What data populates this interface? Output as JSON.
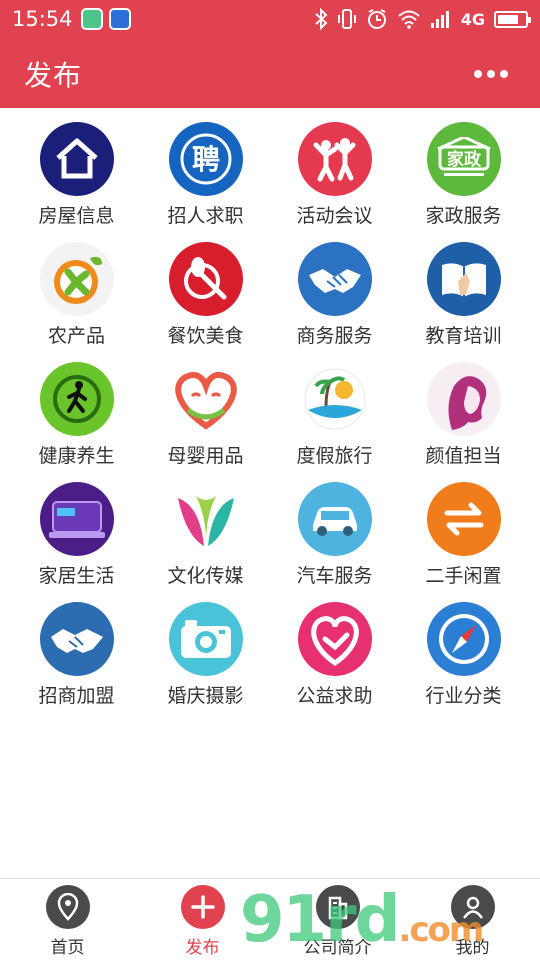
{
  "status_bar": {
    "time": "15:54",
    "network": "4G",
    "battery_level": 0.75,
    "icons": [
      "notification-app-icon",
      "screenshot-icon",
      "bluetooth-icon",
      "vibrate-icon",
      "alarm-icon",
      "wifi-icon",
      "signal-icon",
      "battery-icon"
    ]
  },
  "header": {
    "title": "发布",
    "more_icon": "more-dots-icon",
    "background_color": "#e0434f"
  },
  "categories": [
    {
      "label": "房屋信息",
      "icon": "house-icon",
      "color": "#1a1f7a"
    },
    {
      "label": "招人求职",
      "icon": "recruit-icon",
      "color": "#1565c0"
    },
    {
      "label": "活动会议",
      "icon": "activity-icon",
      "color": "#e53950"
    },
    {
      "label": "家政服务",
      "icon": "housekeeping-icon",
      "color": "#5db93b"
    },
    {
      "label": "农产品",
      "icon": "farm-product-icon",
      "color": "#f3f3f3"
    },
    {
      "label": "餐饮美食",
      "icon": "food-icon",
      "color": "#d81e2c"
    },
    {
      "label": "商务服务",
      "icon": "business-handshake-icon",
      "color": "#2b73c2"
    },
    {
      "label": "教育培训",
      "icon": "education-book-icon",
      "color": "#1f5fa8"
    },
    {
      "label": "健康养生",
      "icon": "health-walk-icon",
      "color": "#6ac52a"
    },
    {
      "label": "母婴用品",
      "icon": "maternal-heart-icon",
      "color": "#ffffff"
    },
    {
      "label": "度假旅行",
      "icon": "vacation-island-icon",
      "color": "#ffffff"
    },
    {
      "label": "颜值担当",
      "icon": "beauty-face-icon",
      "color": "#f6eef3"
    },
    {
      "label": "家居生活",
      "icon": "home-life-sofa-icon",
      "color": "#4a1e86"
    },
    {
      "label": "文化传媒",
      "icon": "culture-media-icon",
      "color": "#ffffff"
    },
    {
      "label": "汽车服务",
      "icon": "car-icon",
      "color": "#4fb3e0"
    },
    {
      "label": "二手闲置",
      "icon": "second-hand-swap-icon",
      "color": "#f07c1c"
    },
    {
      "label": "招商加盟",
      "icon": "franchise-handshake-icon",
      "color": "#2b6db0"
    },
    {
      "label": "婚庆摄影",
      "icon": "camera-icon",
      "color": "#4ac3d9"
    },
    {
      "label": "公益求助",
      "icon": "charity-heart-icon",
      "color": "#e6306f"
    },
    {
      "label": "行业分类",
      "icon": "compass-icon",
      "color": "#2a7fd4"
    }
  ],
  "bottom_nav": [
    {
      "label": "首页",
      "icon": "location-pin-icon",
      "active": false
    },
    {
      "label": "发布",
      "icon": "plus-icon",
      "active": true
    },
    {
      "label": "公司简介",
      "icon": "building-icon",
      "active": false
    },
    {
      "label": "我的",
      "icon": "user-icon",
      "active": false
    }
  ],
  "watermark": {
    "main": "91rd",
    "suffix": ".com"
  }
}
